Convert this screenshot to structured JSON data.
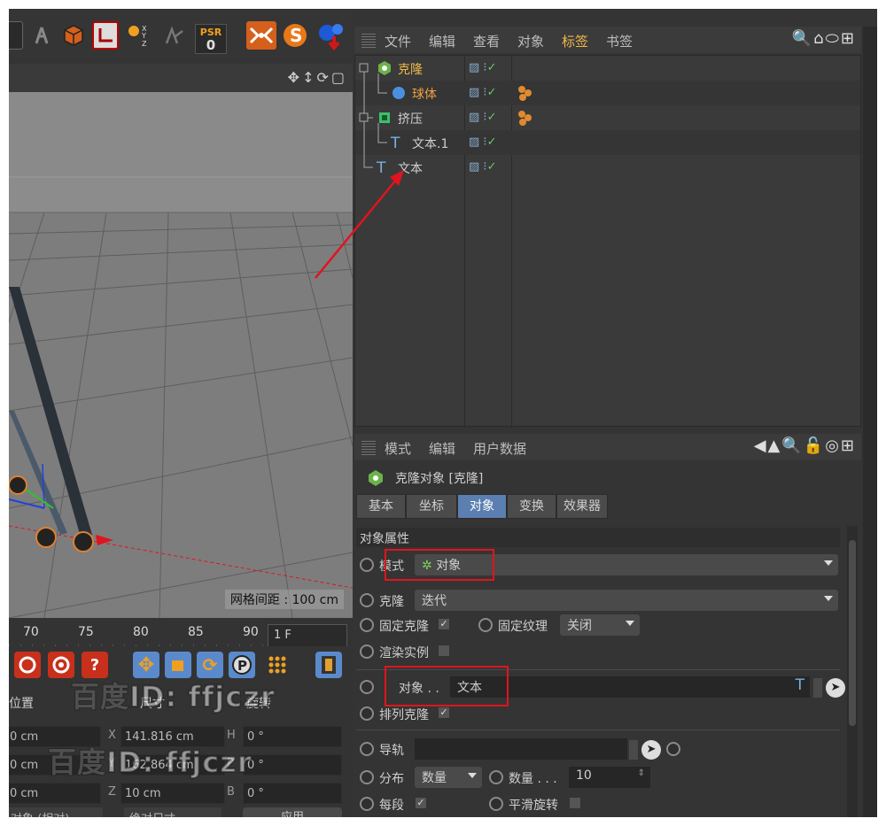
{
  "toolbar": {
    "psr_label": "PSR",
    "psr_value": "0"
  },
  "viewport": {
    "grid_spacing": "网格间距 : 100 cm"
  },
  "timeline": {
    "ticks": [
      "70",
      "75",
      "80",
      "85",
      "90"
    ],
    "frame": "1 F"
  },
  "coords": {
    "position_header": "位置",
    "size_header": "尺寸",
    "rotation_header": "旋转",
    "pos": [
      "0 cm",
      "0 cm",
      "0 cm"
    ],
    "size": [
      "141.816 cm",
      "162.864 cm",
      "10 cm"
    ],
    "axis_size": [
      "X",
      "Y",
      "Z"
    ],
    "axis_rot": [
      "H",
      "P",
      "B"
    ],
    "rot": [
      "0 °",
      "0 °",
      "0 °"
    ],
    "mode": "对象 (相对)",
    "size_mode": "绝对尺寸",
    "apply": "应用"
  },
  "watermark": "百度ID: ffjczr",
  "object_manager": {
    "menu": [
      "文件",
      "编辑",
      "查看",
      "对象",
      "标签",
      "书签"
    ],
    "active_menu": "标签",
    "objects": [
      {
        "name": "克隆",
        "icon": "cloner-icon",
        "color": "#f0b84a"
      },
      {
        "name": "球体",
        "icon": "sphere-icon",
        "color": "#f0a040"
      },
      {
        "name": "挤压",
        "icon": "extrude-icon",
        "color": "#cfcfcf"
      },
      {
        "name": "文本.1",
        "icon": "text-icon",
        "color": "#cfcfcf"
      },
      {
        "name": "文本",
        "icon": "text-icon",
        "color": "#cfcfcf"
      }
    ]
  },
  "attribute_manager": {
    "menu": [
      "模式",
      "编辑",
      "用户数据"
    ],
    "title": "克隆对象 [克隆]",
    "tabs": [
      "基本",
      "坐标",
      "对象",
      "变换",
      "效果器"
    ],
    "active_tab": "对象",
    "section": "对象属性",
    "mode_label": "模式",
    "mode_value": "对象",
    "clone_label": "克隆",
    "clone_value": "迭代",
    "fixed_clone": "固定克隆",
    "fixed_texture": "固定纹理",
    "fixed_texture_value": "关闭",
    "render_instance": "渲染实例",
    "object_label": "对象 . .",
    "object_value": "文本",
    "arrange_clone": "排列克隆",
    "rail_label": "导轨",
    "distribution_label": "分布",
    "distribution_value": "数量",
    "count_label": "数量 . . .",
    "count_value": "10",
    "per_segment": "每段",
    "smooth_rotation": "平滑旋转"
  }
}
